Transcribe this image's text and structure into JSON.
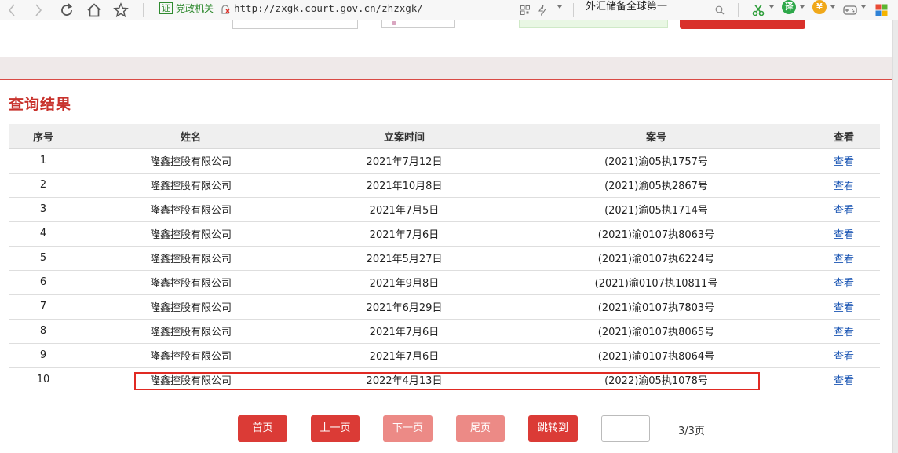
{
  "browser": {
    "cert_badge": "证",
    "site_label": "党政机关",
    "url": "http://zxgk.court.gov.cn/zhzxgk/",
    "search_text": "外汇储备全球第一",
    "ext_translate_glyph": "译",
    "ext_yen_glyph": "¥"
  },
  "section_title": "查询结果",
  "table": {
    "headers": [
      "序号",
      "姓名",
      "立案时间",
      "案号",
      "查看"
    ],
    "rows": [
      {
        "idx": "1",
        "name": "隆鑫控股有限公司",
        "date": "2021年7月12日",
        "case": "(2021)渝05执1757号",
        "view": "查看"
      },
      {
        "idx": "2",
        "name": "隆鑫控股有限公司",
        "date": "2021年10月8日",
        "case": "(2021)渝05执2867号",
        "view": "查看"
      },
      {
        "idx": "3",
        "name": "隆鑫控股有限公司",
        "date": "2021年7月5日",
        "case": "(2021)渝05执1714号",
        "view": "查看"
      },
      {
        "idx": "4",
        "name": "隆鑫控股有限公司",
        "date": "2021年7月6日",
        "case": "(2021)渝0107执8063号",
        "view": "查看"
      },
      {
        "idx": "5",
        "name": "隆鑫控股有限公司",
        "date": "2021年5月27日",
        "case": "(2021)渝0107执6224号",
        "view": "查看"
      },
      {
        "idx": "6",
        "name": "隆鑫控股有限公司",
        "date": "2021年9月8日",
        "case": "(2021)渝0107执10811号",
        "view": "查看"
      },
      {
        "idx": "7",
        "name": "隆鑫控股有限公司",
        "date": "2021年6月29日",
        "case": "(2021)渝0107执7803号",
        "view": "查看"
      },
      {
        "idx": "8",
        "name": "隆鑫控股有限公司",
        "date": "2021年7月6日",
        "case": "(2021)渝0107执8065号",
        "view": "查看"
      },
      {
        "idx": "9",
        "name": "隆鑫控股有限公司",
        "date": "2021年7月6日",
        "case": "(2021)渝0107执8064号",
        "view": "查看"
      },
      {
        "idx": "10",
        "name": "隆鑫控股有限公司",
        "date": "2022年4月13日",
        "case": "(2022)渝05执1078号",
        "view": "查看"
      }
    ]
  },
  "pagination": {
    "first": "首页",
    "prev": "上一页",
    "next": "下一页",
    "last": "尾页",
    "jump": "跳转到",
    "jump_value": "",
    "total": "3/3页"
  },
  "colors": {
    "accent": "#db3b36",
    "accent_disabled": "#ec8a86",
    "title": "#c8322c",
    "link": "#1a55b3",
    "highlight_border": "#e02a23"
  }
}
